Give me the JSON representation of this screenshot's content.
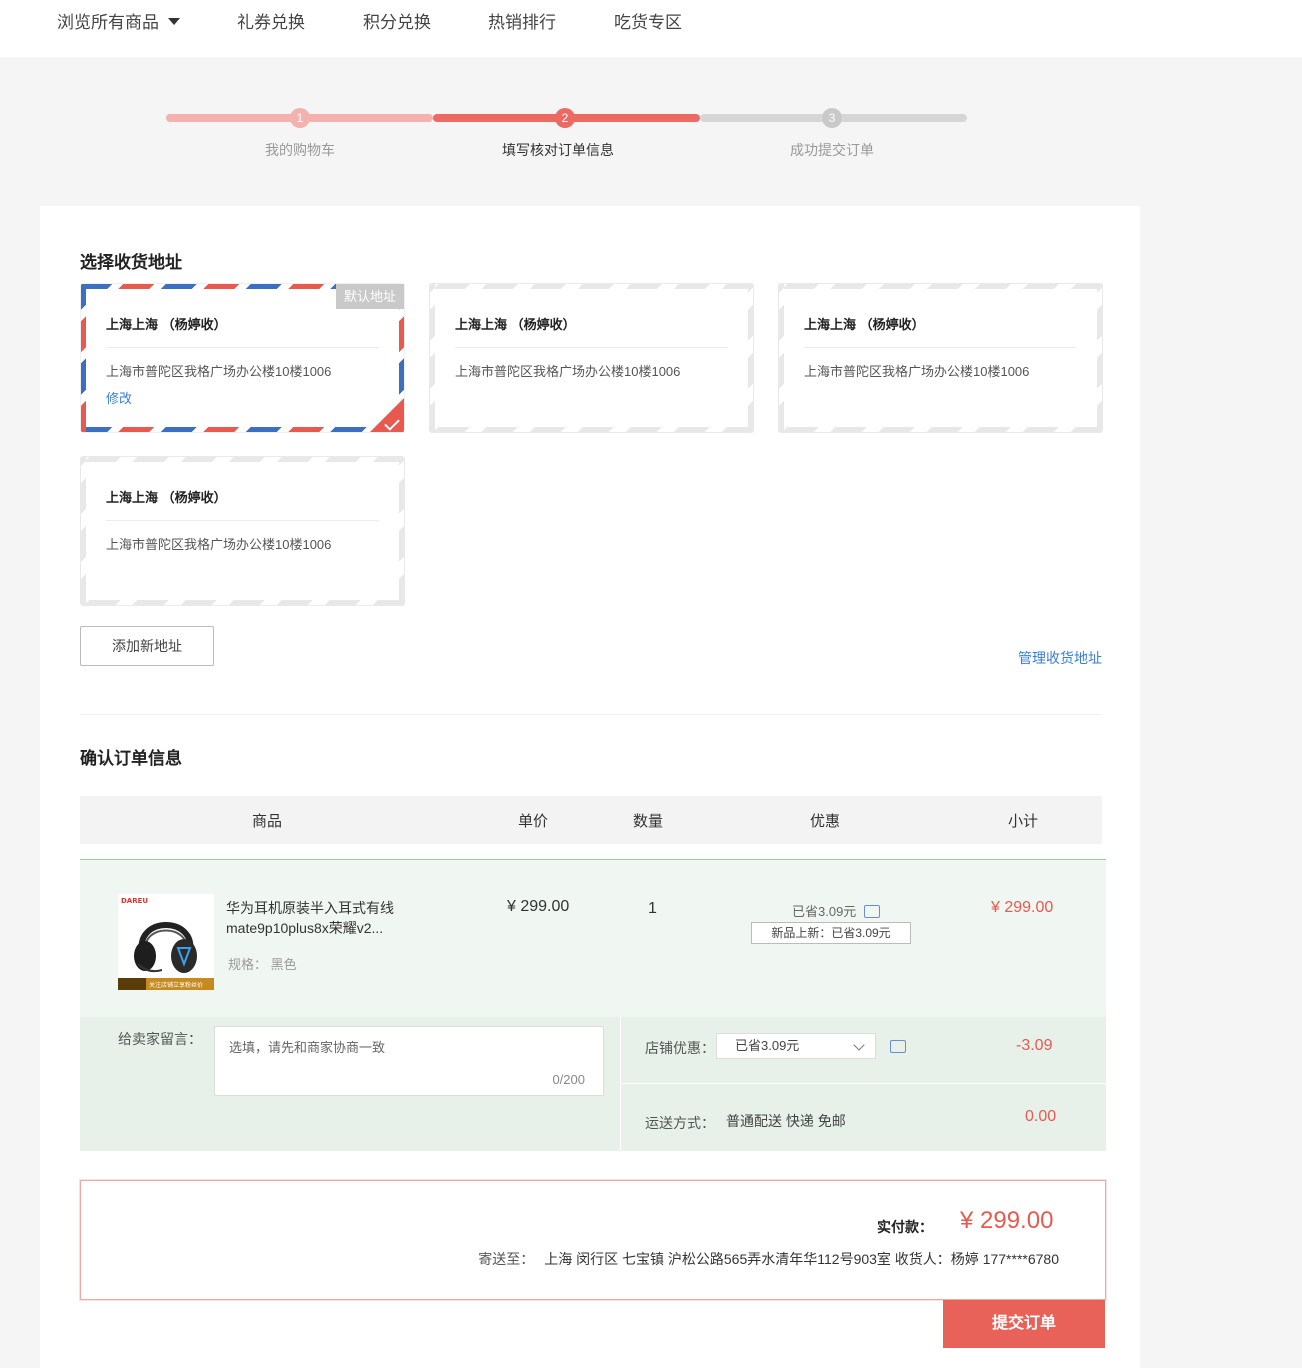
{
  "nav": {
    "browse": "浏览所有商品",
    "items": [
      "礼券兑换",
      "积分兑换",
      "热销排行",
      "吃货专区"
    ]
  },
  "steps": [
    {
      "num": "1",
      "label": "我的购物车"
    },
    {
      "num": "2",
      "label": "填写核对订单信息"
    },
    {
      "num": "3",
      "label": "成功提交订单"
    }
  ],
  "address_section": {
    "title": "选择收货地址",
    "default_tag": "默认地址",
    "edit_label": "修改",
    "cards": [
      {
        "name": "上海上海 （杨婷收）",
        "detail": "上海市普陀区我格广场办公楼10楼1006"
      },
      {
        "name": "上海上海 （杨婷收）",
        "detail": "上海市普陀区我格广场办公楼10楼1006"
      },
      {
        "name": "上海上海 （杨婷收）",
        "detail": "上海市普陀区我格广场办公楼10楼1006"
      },
      {
        "name": "上海上海 （杨婷收）",
        "detail": "上海市普陀区我格广场办公楼10楼1006"
      }
    ],
    "add_button": "添加新地址",
    "manage_link": "管理收货地址"
  },
  "order_section": {
    "title": "确认订单信息",
    "columns": [
      "商品",
      "单价",
      "数量",
      "优惠",
      "小计"
    ],
    "item": {
      "brand": "DAREU",
      "thumb_banner": "关注店铺立享粉丝价",
      "name": "华为耳机原装半入耳式有线mate9p10plus8x荣耀v2...",
      "spec": "规格：  黑色",
      "price": "¥ 299.00",
      "qty": "1",
      "saved": "已省3.09元",
      "promo": "新品上新：已省3.09元",
      "subtotal": "¥ 299.00"
    },
    "message": {
      "label": "给卖家留言：",
      "placeholder": "选填，请先和商家协商一致",
      "count": "0/200"
    },
    "shop_discount": {
      "label": "店铺优惠：",
      "selected": "已省3.09元",
      "value": "-3.09"
    },
    "shipping": {
      "label": "运送方式：",
      "method": "普通配送 快递 免邮",
      "value": "0.00"
    }
  },
  "payment": {
    "label": "实付款：",
    "amount": "¥ 299.00",
    "ship_to_label": "寄送至：",
    "ship_to": "上海 闵行区 七宝镇 沪松公路565弄水清年华112号903室 收货人：杨婷 177****6780"
  },
  "submit_button": "提交订单",
  "colors": {
    "accent": "#e8625a",
    "link": "#3a7fd5",
    "row_bg": "#f0f7f2"
  }
}
